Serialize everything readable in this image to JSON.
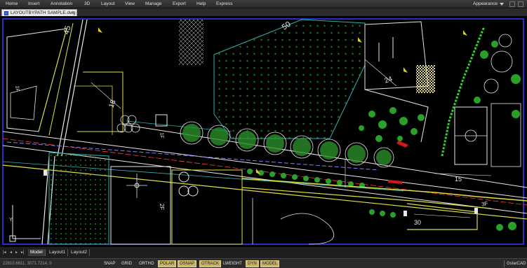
{
  "menu": {
    "items": [
      "Home",
      "Insert",
      "Annotation",
      "3D",
      "Layout",
      "View",
      "Manage",
      "Export",
      "Help",
      "Express"
    ],
    "appearance": "Appearance"
  },
  "document": {
    "tab_title": "LAYOUTBYPATH SAMPLE.dwg"
  },
  "drawing": {
    "labels": {
      "road45": "45",
      "road50": "50",
      "dim24": "24",
      "dim18": "18",
      "dim30": "30",
      "dim15": "15",
      "f1": "1F",
      "f1b": "1F",
      "f2": "2F",
      "f3": "3F",
      "ns": "Y"
    }
  },
  "layout_tabs": {
    "tabs": [
      "Model",
      "Layout1",
      "Layout2"
    ],
    "active": "Model"
  },
  "status": {
    "coords": "22810.6611, 3071.7214, 0",
    "buttons": [
      {
        "label": "SNAP",
        "on": false
      },
      {
        "label": "GRID",
        "on": false
      },
      {
        "label": "ORTHO",
        "on": false
      },
      {
        "label": "POLAR",
        "on": true
      },
      {
        "label": "OSNAP",
        "on": true
      },
      {
        "label": "OTRACK",
        "on": true
      },
      {
        "label": "LWEIGHT",
        "on": false
      },
      {
        "label": "DYN",
        "on": true
      },
      {
        "label": "MODEL",
        "on": true
      }
    ],
    "brand": "GstarCAD"
  }
}
